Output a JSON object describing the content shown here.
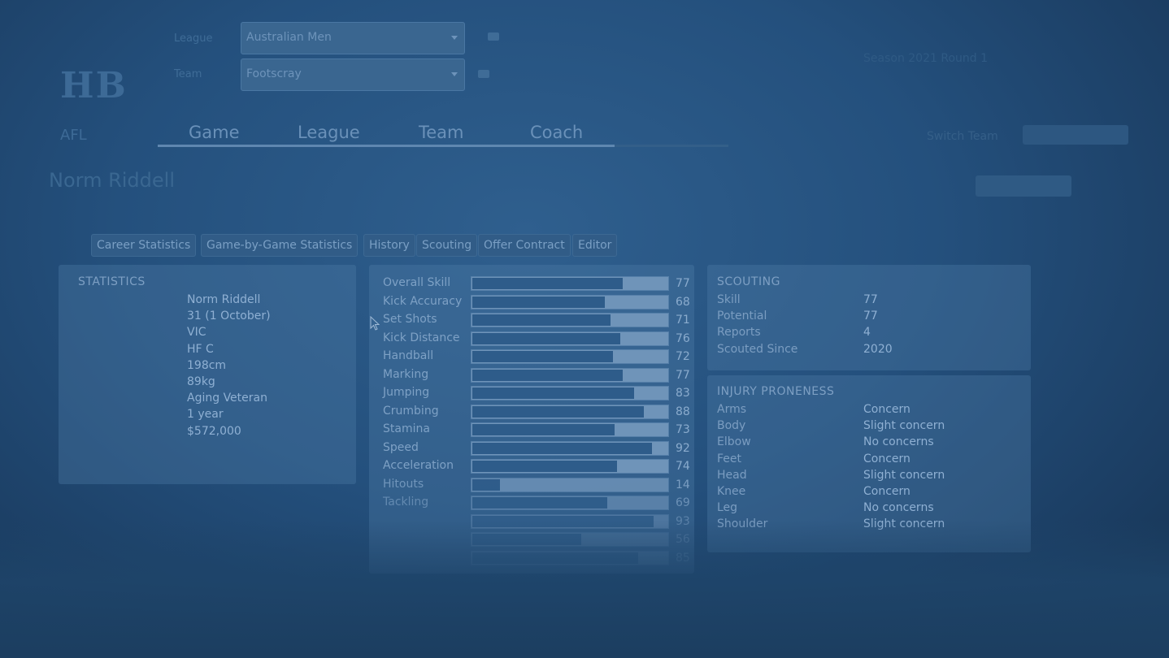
{
  "header": {
    "logo_letters": "HB",
    "logo_sub": "AFL",
    "league_label": "League",
    "team_label": "Team",
    "league_select": "Australian Men",
    "team_select": "Footscray",
    "top_right_text": "Season 2021 Round 1"
  },
  "nav": {
    "items": [
      "Game",
      "League",
      "Team",
      "Coach"
    ],
    "right_text": "Switch Team"
  },
  "player": {
    "name": "Norm Riddell"
  },
  "tabs": [
    "Career Statistics",
    "Game-by-Game Statistics",
    "History",
    "Scouting",
    "Offer Contract",
    "Editor"
  ],
  "statistics": {
    "title": "STATISTICS",
    "values": [
      "Norm Riddell",
      "31 (1 October)",
      "VIC",
      "HF C",
      "198cm",
      "89kg",
      "Aging Veteran",
      "1 year",
      "$572,000"
    ]
  },
  "ratings": [
    {
      "label": "Overall Skill",
      "value": 77
    },
    {
      "label": "Kick Accuracy",
      "value": 68
    },
    {
      "label": "Set Shots",
      "value": 71
    },
    {
      "label": "Kick Distance",
      "value": 76
    },
    {
      "label": "Handball",
      "value": 72
    },
    {
      "label": "Marking",
      "value": 77
    },
    {
      "label": "Jumping",
      "value": 83
    },
    {
      "label": "Crumbing",
      "value": 88
    },
    {
      "label": "Stamina",
      "value": 73
    },
    {
      "label": "Speed",
      "value": 92
    },
    {
      "label": "Acceleration",
      "value": 74
    },
    {
      "label": "Hitouts",
      "value": 14
    },
    {
      "label": "Tackling",
      "value": 69
    },
    {
      "label": "",
      "value": 93
    },
    {
      "label": "",
      "value": 56
    },
    {
      "label": "",
      "value": 85
    }
  ],
  "scouting": {
    "title": "SCOUTING",
    "rows": [
      {
        "key": "Skill",
        "value": "77"
      },
      {
        "key": "Potential",
        "value": "77"
      },
      {
        "key": "Reports",
        "value": "4"
      },
      {
        "key": "Scouted Since",
        "value": "2020"
      }
    ]
  },
  "injury": {
    "title": "INJURY PRONENESS",
    "rows": [
      {
        "key": "Arms",
        "value": "Concern"
      },
      {
        "key": "Body",
        "value": "Slight concern"
      },
      {
        "key": "Elbow",
        "value": "No concerns"
      },
      {
        "key": "Feet",
        "value": "Concern"
      },
      {
        "key": "Head",
        "value": "Slight concern"
      },
      {
        "key": "Knee",
        "value": "Concern"
      },
      {
        "key": "Leg",
        "value": "No concerns"
      },
      {
        "key": "Shoulder",
        "value": "Slight concern"
      }
    ]
  }
}
